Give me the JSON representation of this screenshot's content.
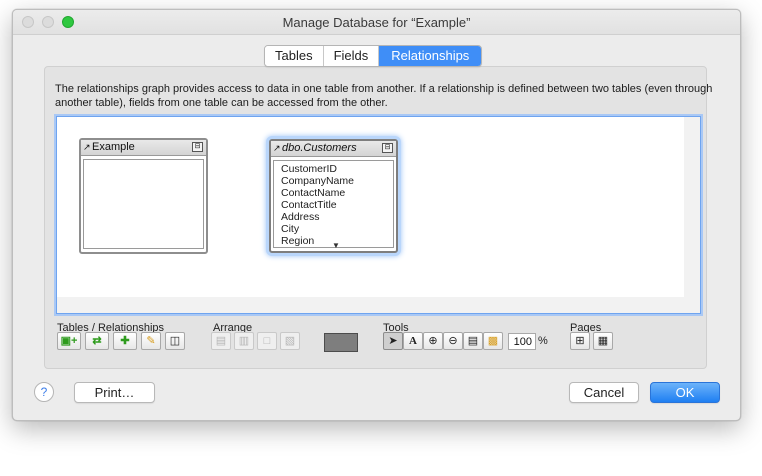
{
  "window": {
    "title": "Manage Database for “Example”"
  },
  "tabs": [
    {
      "label": "Tables",
      "active": false
    },
    {
      "label": "Fields",
      "active": false
    },
    {
      "label": "Relationships",
      "active": true
    }
  ],
  "description": "The relationships graph provides access to data in one table from another. If a relationship is defined between two tables (even through another table), fields from one table can be accessed from the other.",
  "graph": {
    "tables": [
      {
        "name": "Example",
        "fields": [],
        "selected": false
      },
      {
        "name": "dbo.Customers",
        "fields": [
          "CustomerID",
          "CompanyName",
          "ContactName",
          "ContactTitle",
          "Address",
          "City",
          "Region"
        ],
        "selected": true
      }
    ]
  },
  "toolbar": {
    "groups": {
      "tables_relationships": "Tables / Relationships",
      "arrange": "Arrange",
      "tools": "Tools",
      "pages": "Pages"
    },
    "zoom_value": "100",
    "zoom_unit": "%",
    "swatch_color": "#7e7e7e"
  },
  "buttons": {
    "help": "?",
    "print": "Print…",
    "cancel": "Cancel",
    "ok": "OK"
  }
}
